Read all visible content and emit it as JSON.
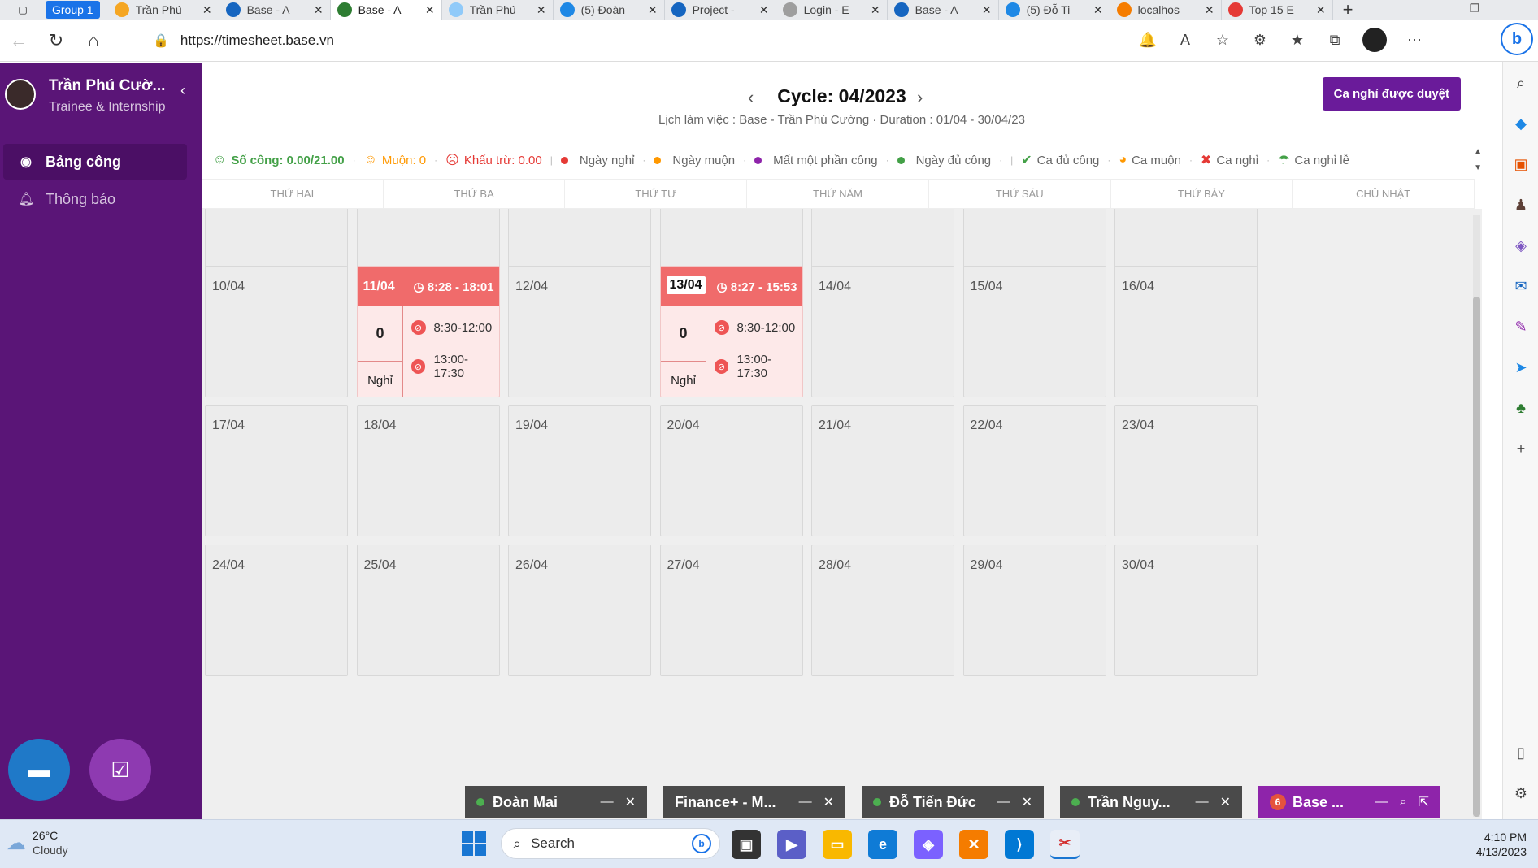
{
  "browser": {
    "group_label": "Group 1",
    "tabs": [
      {
        "title": "Trần Phú",
        "icon_color": "#f5a623"
      },
      {
        "title": "Base - A",
        "icon_color": "#1565c0"
      },
      {
        "title": "Base - A",
        "icon_color": "#2e7d32",
        "active": true
      },
      {
        "title": "Trần Phú",
        "icon_color": "#90caf9"
      },
      {
        "title": "(5) Đoàn",
        "icon_color": "#1e88e5"
      },
      {
        "title": "Project -",
        "icon_color": "#1565c0"
      },
      {
        "title": "Login - E",
        "icon_color": "#9e9e9e"
      },
      {
        "title": "Base - A",
        "icon_color": "#1565c0"
      },
      {
        "title": "(5) Đỗ Ti",
        "icon_color": "#1e88e5"
      },
      {
        "title": "localhos",
        "icon_color": "#f57c00"
      },
      {
        "title": "Top 15 E",
        "icon_color": "#e53935"
      }
    ],
    "url": "https://timesheet.base.vn"
  },
  "sidebar": {
    "user_name": "Trần Phú Cườ...",
    "user_role": "Trainee & Internship",
    "items": [
      {
        "label": "Bảng công",
        "active": true
      },
      {
        "label": "Thông báo",
        "active": false
      }
    ]
  },
  "header": {
    "cycle_title": "Cycle: 04/2023",
    "subtitle": "Lịch làm việc : Base - Trần Phú Cường · Duration : 01/04 - 30/04/23",
    "approved_button": "Ca nghỉ được duyệt"
  },
  "legend": {
    "so_cong": "Số công: 0.00/21.00",
    "muon": "Muộn: 0",
    "khau_tru": "Khấu trừ: 0.00",
    "items": [
      {
        "label": "Ngày nghỉ",
        "color": "#e53935"
      },
      {
        "label": "Ngày muộn",
        "color": "#ff9800"
      },
      {
        "label": "Mất một phần công",
        "color": "#8e24aa"
      },
      {
        "label": "Ngày đủ công",
        "color": "#43a047"
      }
    ],
    "shift_items": [
      {
        "label": "Ca đủ công",
        "icon": "check-circle-icon",
        "color": "#43a047"
      },
      {
        "label": "Ca muộn",
        "icon": "pie-icon",
        "color": "#ff9800"
      },
      {
        "label": "Ca nghỉ",
        "icon": "x-circle-icon",
        "color": "#e53935"
      },
      {
        "label": "Ca nghỉ lễ",
        "icon": "umbrella-icon",
        "color": "#43a047"
      }
    ]
  },
  "weekdays": [
    "THỨ HAI",
    "THỨ BA",
    "THỨ TƯ",
    "THỨ NĂM",
    "THỨ SÁU",
    "THỨ BẢY",
    "CHỦ NHẬT"
  ],
  "weeks": [
    [
      "",
      "",
      "",
      "",
      "",
      "",
      ""
    ],
    [
      "10/04",
      "11/04",
      "12/04",
      "13/04",
      "14/04",
      "15/04",
      "16/04"
    ],
    [
      "17/04",
      "18/04",
      "19/04",
      "20/04",
      "21/04",
      "22/04",
      "23/04"
    ],
    [
      "24/04",
      "25/04",
      "26/04",
      "27/04",
      "28/04",
      "29/04",
      "30/04"
    ]
  ],
  "leave_days": [
    {
      "date": "11/04",
      "time": "8:28 - 18:01",
      "count": "0",
      "state": "Nghỉ",
      "shifts": [
        "8:30-12:00",
        "13:00-17:30"
      ]
    },
    {
      "date": "13/04",
      "time": "8:27 - 15:53",
      "count": "0",
      "state": "Nghỉ",
      "shifts": [
        "8:30-12:00",
        "13:00-17:30"
      ]
    }
  ],
  "chats": [
    {
      "name": "Đoàn Mai"
    },
    {
      "name": "Finance+ - M..."
    },
    {
      "name": "Đỗ Tiến Đức"
    },
    {
      "name": "Trần Nguy..."
    },
    {
      "name": "Base ...",
      "badge": "6"
    }
  ],
  "taskbar": {
    "temp": "26°C",
    "condition": "Cloudy",
    "search_placeholder": "Search",
    "time": "4:10 PM",
    "date": "4/13/2023"
  }
}
